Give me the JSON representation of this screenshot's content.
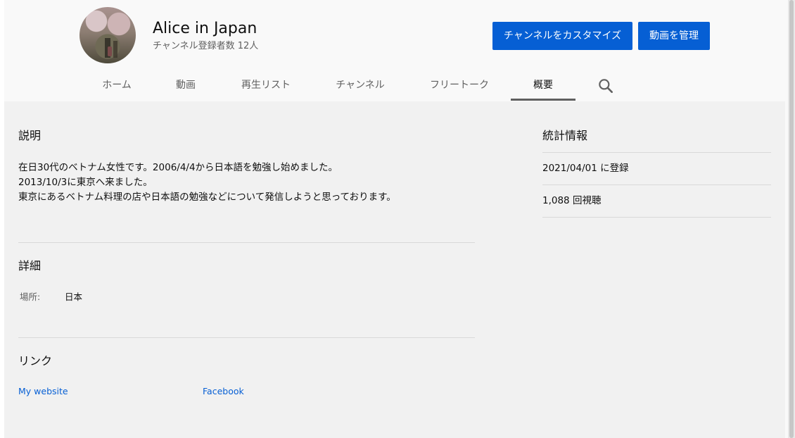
{
  "channel": {
    "name": "Alice in Japan",
    "subscribers": "チャンネル登録者数 12人"
  },
  "buttons": {
    "customize": "チャンネルをカスタマイズ",
    "manage": "動画を管理"
  },
  "tabs": [
    {
      "label": "ホーム",
      "active": false
    },
    {
      "label": "動画",
      "active": false
    },
    {
      "label": "再生リスト",
      "active": false
    },
    {
      "label": "チャンネル",
      "active": false
    },
    {
      "label": "フリートーク",
      "active": false
    },
    {
      "label": "概要",
      "active": true
    }
  ],
  "icons": {
    "search": "search-icon"
  },
  "about": {
    "description_title": "説明",
    "description_lines": [
      "在日30代のベトナム女性です。2006/4/4から日本語を勉強し始めました。",
      "2013/10/3に東京へ来ました。",
      "東京にあるベトナム料理の店や日本語の勉強などについて発信しようと思っております。"
    ],
    "details_title": "詳細",
    "location_label": "場所:",
    "location_value": "日本",
    "links_title": "リンク",
    "links": [
      "My website",
      "Facebook"
    ]
  },
  "stats": {
    "title": "統計情報",
    "joined": "2021/04/01 に登録",
    "views": "1,088 回視聴"
  },
  "colors": {
    "primary_button": "#065fd4",
    "link": "#065fd4",
    "page_bg": "#f9f9f9",
    "content_bg": "#f1f1f1"
  }
}
